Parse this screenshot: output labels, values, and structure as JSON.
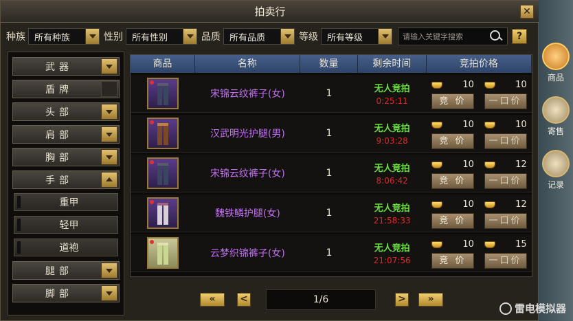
{
  "window": {
    "title": "拍卖行",
    "close_label": "✕"
  },
  "filters": {
    "race_label": "种族",
    "race_value": "所有种族",
    "gender_label": "性别",
    "gender_value": "所有性别",
    "quality_label": "品质",
    "quality_value": "所有品质",
    "level_label": "等级",
    "level_value": "所有等级",
    "search_placeholder": "请输入关键字搜索",
    "help_label": "?"
  },
  "categories": [
    {
      "label": "武器",
      "arrow": "down"
    },
    {
      "label": "盾牌",
      "arrow": "none"
    },
    {
      "label": "头部",
      "arrow": "down"
    },
    {
      "label": "肩部",
      "arrow": "down"
    },
    {
      "label": "胸部",
      "arrow": "down"
    },
    {
      "label": "手部",
      "arrow": "up"
    }
  ],
  "subcategories": [
    "重甲",
    "轻甲",
    "道袍"
  ],
  "categories_after": [
    {
      "label": "腿部",
      "arrow": "down"
    },
    {
      "label": "脚部",
      "arrow": "down"
    }
  ],
  "table": {
    "headers": [
      "商品",
      "名称",
      "数量",
      "剩余时间",
      "竞拍价格"
    ],
    "bid_label": "竞 价",
    "buyout_label": "一口价",
    "rows": [
      {
        "name": "宋锦云纹裤子(女)",
        "qty": "1",
        "status": "无人竞拍",
        "time": "0:25:11",
        "bid": "10",
        "buyout": "10"
      },
      {
        "name": "汉武明光护腿(男)",
        "qty": "1",
        "status": "无人竞拍",
        "time": "9:03:28",
        "bid": "10",
        "buyout": "10"
      },
      {
        "name": "宋锦云纹裤子(女)",
        "qty": "1",
        "status": "无人竞拍",
        "time": "8:06:42",
        "bid": "10",
        "buyout": "12"
      },
      {
        "name": "魏铁鳞护腿(女)",
        "qty": "1",
        "status": "无人竞拍",
        "time": "21:58:33",
        "bid": "10",
        "buyout": "12"
      },
      {
        "name": "云梦织锦裤子(女)",
        "qty": "1",
        "status": "无人竞拍",
        "time": "21:07:56",
        "bid": "10",
        "buyout": "15"
      }
    ]
  },
  "pager": {
    "first": "«",
    "prev": "<",
    "info": "1/6",
    "next": ">",
    "last": "»"
  },
  "dock": {
    "tab1": "商品",
    "tab2": "寄售",
    "tab3": "记录"
  },
  "watermark": "雷电模拟器",
  "colors": {
    "item_name": "#c070f0",
    "no_bid": "#6ae040",
    "time_left": "#e02828"
  }
}
